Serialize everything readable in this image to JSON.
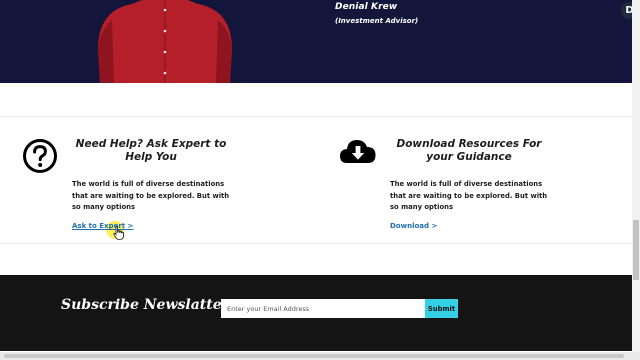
{
  "advisor": {
    "name": "Denial Krew",
    "role": "(Investment Advisor)"
  },
  "extension_badge": "D",
  "help_card": {
    "icon": "question-circle-icon",
    "title_line1": "Need Help? Ask Expert to",
    "title_line2": "Help You",
    "text_line1": "The world is full of diverse destinations",
    "text_line2": "that are waiting to be explored. But with",
    "text_line3": "so many options",
    "link": "Ask to Expert >"
  },
  "download_card": {
    "icon": "cloud-download-icon",
    "title_line1": "Download Resources For",
    "title_line2": "your Guidance",
    "text_line1": "The world is full of diverse destinations",
    "text_line2": "that are waiting to be explored. But with",
    "text_line3": "so many options",
    "link": "Download >"
  },
  "subscribe": {
    "title": "Subscribe Newslatter",
    "placeholder": "Enter your Email Address",
    "button": "Submit"
  },
  "colors": {
    "hero_bg": "#13163a",
    "footer_bg": "#141414",
    "link": "#1f6fb0",
    "submit_bg": "#34d1e6",
    "shirt": "#b51f2a"
  }
}
